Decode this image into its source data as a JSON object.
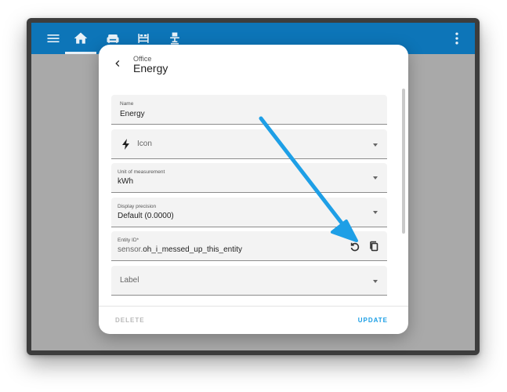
{
  "header": {
    "icons": [
      "menu-icon",
      "home-icon",
      "sofa-icon",
      "bed-icon",
      "desk-icon",
      "overflow-menu-icon"
    ]
  },
  "dialog": {
    "breadcrumb": "Office",
    "title": "Energy",
    "fields": {
      "name": {
        "label": "Name",
        "value": "Energy"
      },
      "icon": {
        "placeholder": "Icon",
        "icon": "lightning-bolt-icon"
      },
      "unit": {
        "label": "Unit of measurement",
        "value": "kWh"
      },
      "precision": {
        "label": "Display precision",
        "value": "Default (0.0000)"
      },
      "entity_id": {
        "label": "Entity ID*",
        "prefix": "sensor.",
        "value": "oh_i_messed_up_this_entity"
      },
      "label": {
        "placeholder": "Label"
      }
    },
    "actions": {
      "delete": "DELETE",
      "update": "UPDATE"
    }
  },
  "colors": {
    "header": "#0d75b8",
    "accent": "#1a9ee5",
    "annotation_arrow": "#1e9fe6"
  }
}
